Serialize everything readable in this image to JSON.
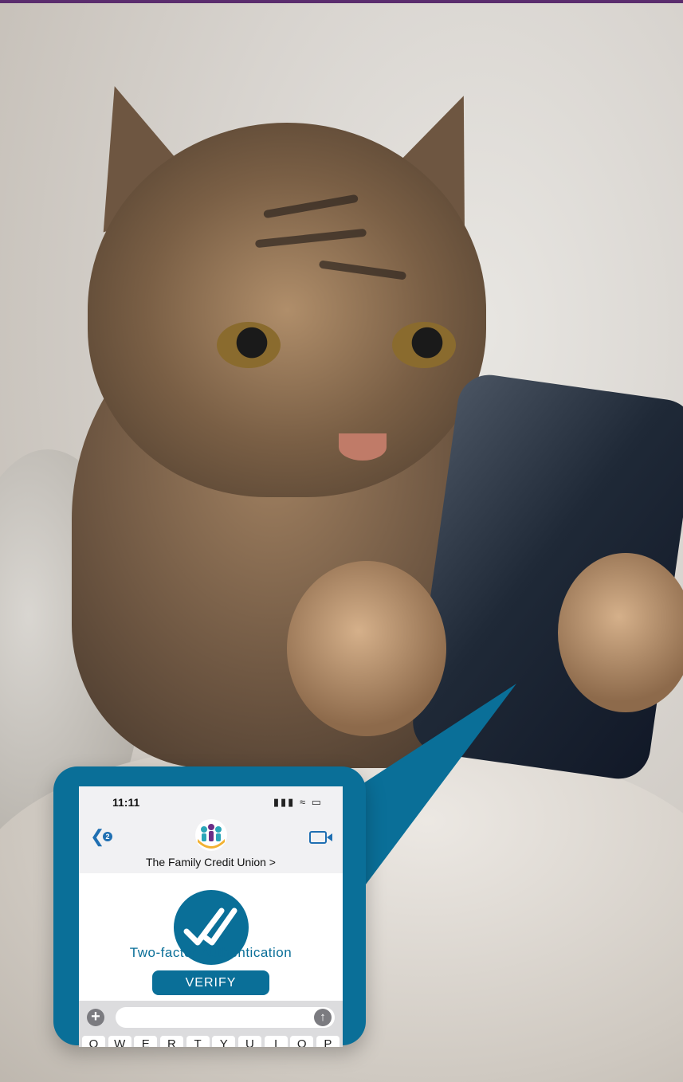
{
  "phone": {
    "time": "11:11",
    "status_icons": "signal-wifi-battery-icons",
    "back_badge": "2",
    "contact_name": "The Family Credit Union >",
    "message": {
      "title": "Two-factor Authentication",
      "button_label": "VERIFY"
    },
    "keyboard_row": [
      "Q",
      "W",
      "E",
      "R",
      "T",
      "Y",
      "U",
      "I",
      "O",
      "P"
    ]
  },
  "colors": {
    "accent": "#0a6f98",
    "top_strip": "#5b2d6e",
    "ios_blue": "#1f6fb2"
  }
}
